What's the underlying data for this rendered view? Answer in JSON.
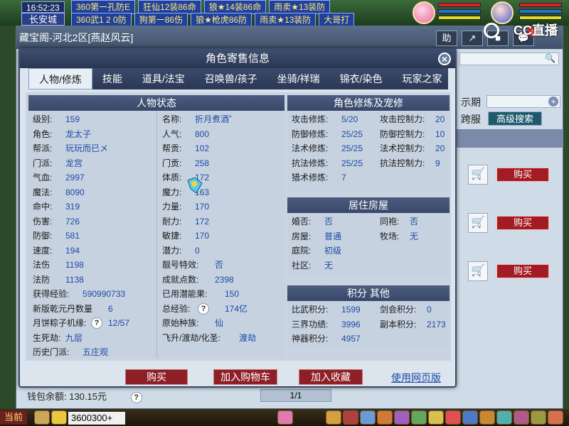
{
  "hud": {
    "clock": "16:52:23",
    "location": "长安城",
    "ticker_top": [
      "360第一孔防E",
      "狂仙12装86命",
      "狼★14装86命",
      "雨卖★13装防"
    ],
    "ticker_bottom": [
      "360武1 2 0防",
      "狗第一86伤",
      "狼★枪虎86防",
      "雨卖★13装防",
      "大哥打"
    ],
    "cc_logo": "CC直播",
    "chat_tag": "当前",
    "chat_input": "3600300+"
  },
  "bg_window": {
    "title": "藏宝阁-河北2区[燕赵风云]",
    "tools": [
      "助",
      "↗",
      "■",
      "💬"
    ],
    "message_badge": "1",
    "show_period_label": "示期",
    "cross_server_label": "跨服",
    "advanced_search": "高级搜索",
    "buy_label": "购买",
    "wallet_text": "钱包余额: 130.15元",
    "pager": "1/1"
  },
  "modal": {
    "title": "角色寄售信息",
    "tabs": [
      "人物/修炼",
      "技能",
      "道具/法宝",
      "召唤兽/孩子",
      "坐骑/祥瑞",
      "锦衣/染色",
      "玩家之家"
    ],
    "active_tab": 0,
    "status_panel": {
      "title": "人物状态",
      "left": [
        {
          "label": "级别:",
          "value": "159"
        },
        {
          "label": "角色:",
          "value": "龙太子"
        },
        {
          "label": "帮派:",
          "value": "玩玩而已メ"
        },
        {
          "label": "门派:",
          "value": "龙宫"
        },
        {
          "label": "气血:",
          "value": "2997"
        },
        {
          "label": "魔法:",
          "value": "8090"
        },
        {
          "label": "命中:",
          "value": "319"
        },
        {
          "label": "伤害:",
          "value": "726"
        },
        {
          "label": "防御:",
          "value": "581"
        },
        {
          "label": "速度:",
          "value": "194"
        },
        {
          "label": "法伤",
          "value": "1198"
        },
        {
          "label": "法防",
          "value": "1138"
        }
      ],
      "right": [
        {
          "label": "名称:",
          "value": "折月煮酒˚"
        },
        {
          "label": "人气:",
          "value": "800"
        },
        {
          "label": "帮贡:",
          "value": "102"
        },
        {
          "label": "门贡:",
          "value": "258"
        },
        {
          "label": "体质:",
          "value": "172"
        },
        {
          "label": "魔力:",
          "value": "163"
        },
        {
          "label": "力量:",
          "value": "170"
        },
        {
          "label": "耐力:",
          "value": "172"
        },
        {
          "label": "敏捷:",
          "value": "170"
        },
        {
          "label": "潜力:",
          "value": "0"
        },
        {
          "label": "靓号特效:",
          "value": "否"
        },
        {
          "label": "成就点数:",
          "value": "2398"
        }
      ],
      "extra": {
        "exp_label": "获得经验:",
        "exp_value": "590990733",
        "unused_potential_label": "已用潜能果:",
        "unused_potential_value": "150",
        "qianyuan_label": "新版乾元丹数量",
        "qianyuan_value": "6",
        "total_exp_label": "总经验:",
        "total_exp_value": "174亿",
        "mooncake_label": "月饼粽子机缘:",
        "mooncake_value": "12/57",
        "origin_race_label": "原始种族:",
        "origin_race_value": "仙",
        "life_death_label": "生死劫:",
        "life_death_value": "九层",
        "ascend_label": "飞升/渡劫/化圣:",
        "ascend_value": "渡劫",
        "history_school_label": "历史门派:",
        "history_school_value": "五庄观"
      }
    },
    "cultivation_panel": {
      "title": "角色修炼及宠修",
      "rows": [
        {
          "label": "攻击修炼:",
          "value": "5/20",
          "label2": "攻击控制力:",
          "value2": "20"
        },
        {
          "label": "防御修炼:",
          "value": "25/25",
          "label2": "防御控制力:",
          "value2": "10"
        },
        {
          "label": "法术修炼:",
          "value": "25/25",
          "label2": "法术控制力:",
          "value2": "20"
        },
        {
          "label": "抗法修炼:",
          "value": "25/25",
          "label2": "抗法控制力:",
          "value2": "9"
        },
        {
          "label": "猎术修炼:",
          "value": "7",
          "label2": "",
          "value2": ""
        }
      ]
    },
    "housing_panel": {
      "title": "居住房屋",
      "rows": [
        {
          "label": "婚否:",
          "value": "否",
          "label2": "同袍:",
          "value2": "否"
        },
        {
          "label": "房屋:",
          "value": "普通",
          "label2": "牧场:",
          "value2": "无"
        },
        {
          "label": "庭院:",
          "value": "初级",
          "label2": "",
          "value2": ""
        },
        {
          "label": "社区:",
          "value": "无",
          "label2": "",
          "value2": ""
        }
      ]
    },
    "score_panel": {
      "title": "积分 其他",
      "rows": [
        {
          "label": "比武积分:",
          "value": "1599",
          "label2": "剑会积分:",
          "value2": "0"
        },
        {
          "label": "三界功绩:",
          "value": "3996",
          "label2": "副本积分:",
          "value2": "2173"
        },
        {
          "label": "神器积分:",
          "value": "4957",
          "label2": "",
          "value2": ""
        }
      ]
    },
    "footer": {
      "buy": "购买",
      "add_cart": "加入购物车",
      "add_fav": "加入收藏",
      "web_version": "使用网页版"
    }
  },
  "colors": {
    "modal_bg": "#dce4ee",
    "panel_head": "#3e4e70",
    "value_blue": "#1c4aa6",
    "buy_red": "#8e1f26"
  }
}
